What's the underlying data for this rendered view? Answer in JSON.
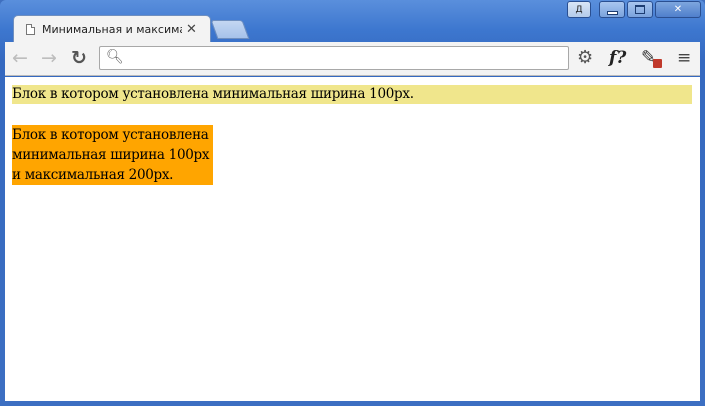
{
  "window": {
    "user_label": "Д",
    "close_glyph": "✕"
  },
  "tab": {
    "title": "Минимальная и максимальн",
    "close_glyph": "✕"
  },
  "toolbar": {
    "back_glyph": "←",
    "forward_glyph": "→",
    "reload_glyph": "↻",
    "address_value": "",
    "extensions": {
      "gear_icon": "⚙",
      "fx_label": "f?",
      "dropper_icon": "✎",
      "menu_icon": "≡"
    }
  },
  "page": {
    "block1_text": "Блок в котором установлена минимальная ширина 100px.",
    "block2_lines": [
      "Блок в котором установлена",
      "минимальная ширина 100px",
      "и максимальная 200px."
    ]
  },
  "colors": {
    "block1_bg": "#f0e68c",
    "block2_bg": "#ffa500"
  }
}
